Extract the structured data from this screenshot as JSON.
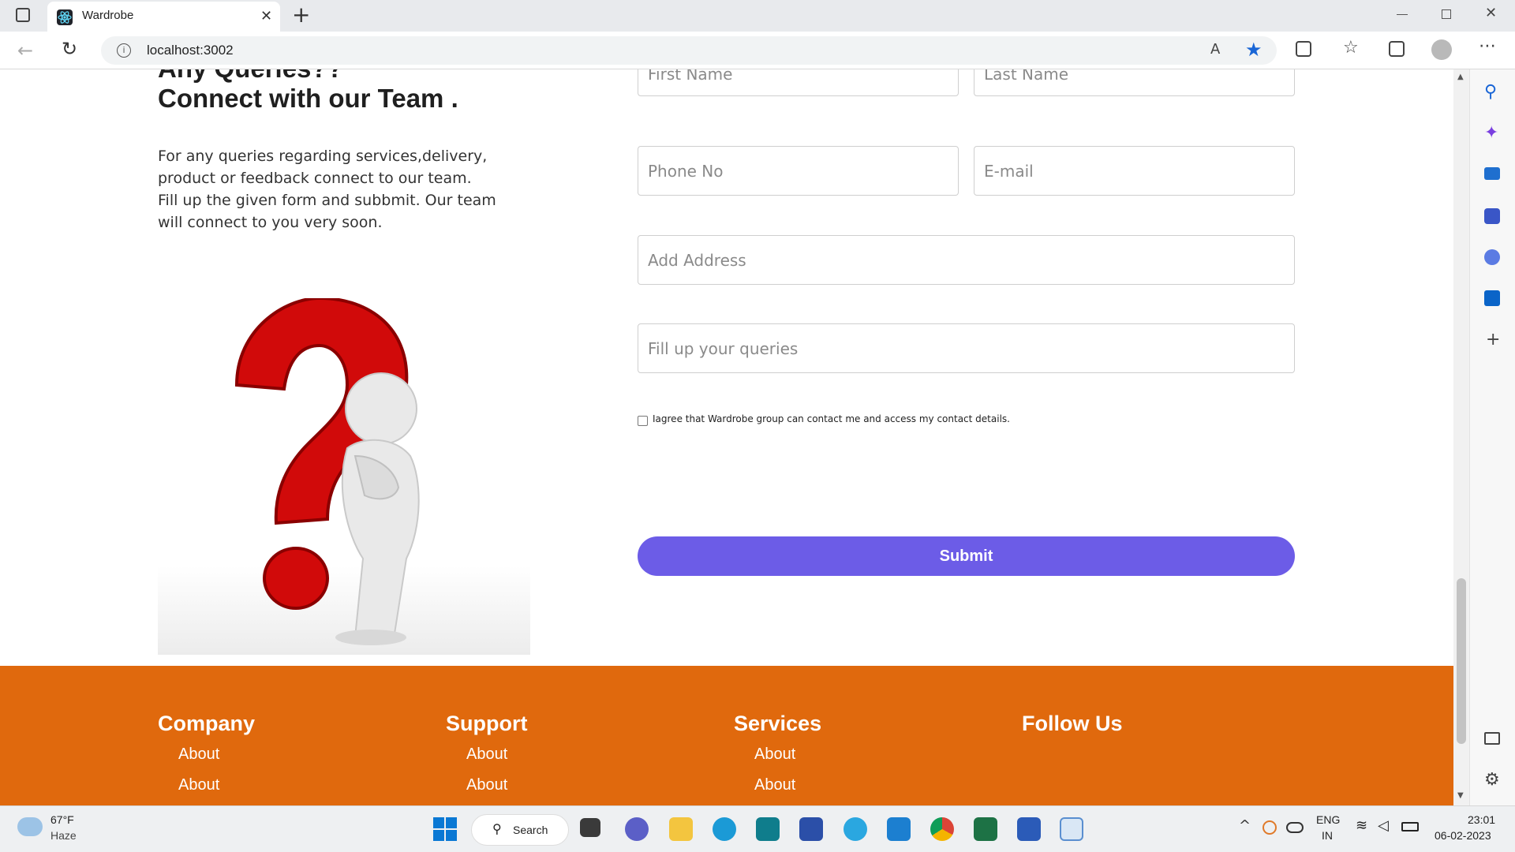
{
  "browser": {
    "tab_title": "Wardrobe",
    "url": "localhost:3002"
  },
  "contact": {
    "heading_line1": "Any Queries??",
    "heading_line2": "Connect with our Team .",
    "description": [
      "For any queries regarding services,delivery,",
      "product or feedback connect to our team.",
      "Fill up the given form and subbmit. Our team",
      "will connect to you very soon."
    ],
    "form": {
      "first_name_placeholder": "First Name",
      "last_name_placeholder": "Last Name",
      "phone_placeholder": "Phone No",
      "email_placeholder": "E-mail",
      "address_placeholder": "Add Address",
      "queries_placeholder": "Fill up your queries",
      "consent_label": "Iagree that Wardrobe group can contact me and access my contact details.",
      "submit_label": "Submit"
    }
  },
  "footer": {
    "columns": [
      {
        "title": "Company",
        "links": [
          "About",
          "About"
        ]
      },
      {
        "title": "Support",
        "links": [
          "About",
          "About"
        ]
      },
      {
        "title": "Services",
        "links": [
          "About",
          "About"
        ]
      },
      {
        "title": "Follow Us",
        "links": []
      }
    ]
  },
  "taskbar": {
    "weather_temp": "67°F",
    "weather_desc": "Haze",
    "search_label": "Search",
    "lang_line1": "ENG",
    "lang_line2": "IN",
    "time": "23:01",
    "date": "06-02-2023"
  },
  "colors": {
    "accent": "#6c5ce7",
    "footer": "#e0690d"
  }
}
